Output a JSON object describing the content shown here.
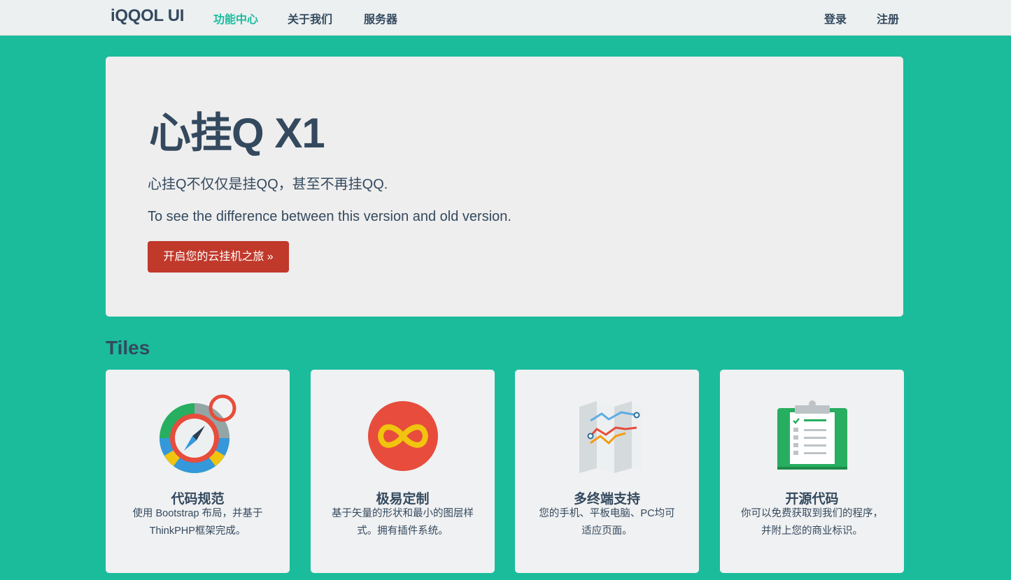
{
  "navbar": {
    "brand": "iQQOL UI",
    "items": [
      {
        "label": "功能中心",
        "active": true
      },
      {
        "label": "关于我们",
        "active": false
      },
      {
        "label": "服务器",
        "active": false
      }
    ],
    "right": [
      {
        "label": "登录"
      },
      {
        "label": "注册"
      }
    ]
  },
  "hero": {
    "title": "心挂Q X1",
    "subtitle": "心挂Q不仅仅是挂QQ，甚至不再挂QQ.",
    "description": "To see the difference between this version and old version.",
    "button_label": "开启您的云挂机之旅 »"
  },
  "tiles_section": {
    "title": "Tiles",
    "tiles": [
      {
        "icon": "compass-icon",
        "title": "代码规范",
        "description": "使用 Bootstrap 布局，并基于 ThinkPHP框架完成。"
      },
      {
        "icon": "infinity-icon",
        "title": "极易定制",
        "description": "基于矢量的形状和最小的图层样式。拥有插件系统。"
      },
      {
        "icon": "map-icon",
        "title": "多终端支持",
        "description": "您的手机、平板电脑、PC均可适应页面。"
      },
      {
        "icon": "clipboard-icon",
        "title": "开源代码",
        "description": "你可以免费获取到我们的程序，并附上您的商业标识。"
      }
    ]
  },
  "colors": {
    "background": "#1abc9c",
    "navbar": "#ecf0f1",
    "text": "#34495e",
    "accent": "#1abc9c",
    "button": "#c0392b"
  }
}
